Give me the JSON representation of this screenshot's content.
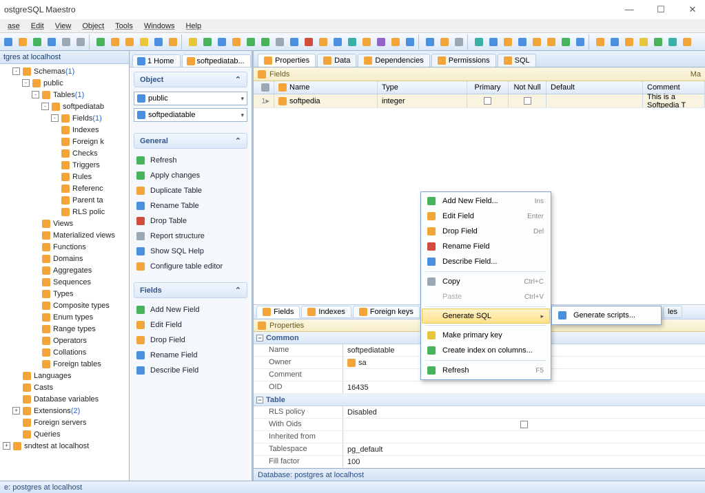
{
  "titlebar": {
    "title": "ostgreSQL Maestro"
  },
  "menu": {
    "items": [
      "ase",
      "Edit",
      "View",
      "Object",
      "Tools",
      "Windows",
      "Help"
    ]
  },
  "left": {
    "header": "tgres at localhost",
    "tree": [
      {
        "depth": 1,
        "exp": "-",
        "ico": "🟧",
        "label": "Schemas",
        "count": "(1)"
      },
      {
        "depth": 2,
        "exp": "-",
        "ico": "🔷",
        "label": "public"
      },
      {
        "depth": 3,
        "exp": "-",
        "ico": "🟧",
        "label": "Tables",
        "count": "(1)"
      },
      {
        "depth": 4,
        "exp": "-",
        "ico": "📄",
        "label": "softpediatab"
      },
      {
        "depth": 5,
        "exp": "-",
        "ico": "🟧",
        "label": "Fields",
        "count": "(1)"
      },
      {
        "depth": 5,
        "exp": "",
        "ico": "🟧",
        "label": "Indexes"
      },
      {
        "depth": 5,
        "exp": "",
        "ico": "🟧",
        "label": "Foreign k"
      },
      {
        "depth": 5,
        "exp": "",
        "ico": "🟧",
        "label": "Checks"
      },
      {
        "depth": 5,
        "exp": "",
        "ico": "🟧",
        "label": "Triggers"
      },
      {
        "depth": 5,
        "exp": "",
        "ico": "🟧",
        "label": "Rules"
      },
      {
        "depth": 5,
        "exp": "",
        "ico": "🟧",
        "label": "Referenc"
      },
      {
        "depth": 5,
        "exp": "",
        "ico": "🟧",
        "label": "Parent ta"
      },
      {
        "depth": 5,
        "exp": "",
        "ico": "🟧",
        "label": "RLS polic"
      },
      {
        "depth": 3,
        "exp": "",
        "ico": "🟧",
        "label": "Views"
      },
      {
        "depth": 3,
        "exp": "",
        "ico": "🟧",
        "label": "Materialized views"
      },
      {
        "depth": 3,
        "exp": "",
        "ico": "🟧",
        "label": "Functions"
      },
      {
        "depth": 3,
        "exp": "",
        "ico": "🟧",
        "label": "Domains"
      },
      {
        "depth": 3,
        "exp": "",
        "ico": "🟧",
        "label": "Aggregates"
      },
      {
        "depth": 3,
        "exp": "",
        "ico": "🟧",
        "label": "Sequences"
      },
      {
        "depth": 3,
        "exp": "",
        "ico": "🟧",
        "label": "Types"
      },
      {
        "depth": 3,
        "exp": "",
        "ico": "🟧",
        "label": "Composite types"
      },
      {
        "depth": 3,
        "exp": "",
        "ico": "🟧",
        "label": "Enum types"
      },
      {
        "depth": 3,
        "exp": "",
        "ico": "🟧",
        "label": "Range types"
      },
      {
        "depth": 3,
        "exp": "",
        "ico": "🟧",
        "label": "Operators"
      },
      {
        "depth": 3,
        "exp": "",
        "ico": "🟧",
        "label": "Collations"
      },
      {
        "depth": 3,
        "exp": "",
        "ico": "🟧",
        "label": "Foreign tables"
      },
      {
        "depth": 1,
        "exp": "",
        "ico": "🟧",
        "label": "Languages"
      },
      {
        "depth": 1,
        "exp": "",
        "ico": "🟧",
        "label": "Casts"
      },
      {
        "depth": 1,
        "exp": "",
        "ico": "🟧",
        "label": "Database variables"
      },
      {
        "depth": 1,
        "exp": "+",
        "ico": "🟧",
        "label": "Extensions",
        "count": "(2)"
      },
      {
        "depth": 1,
        "exp": "",
        "ico": "🟧",
        "label": "Foreign servers"
      },
      {
        "depth": 1,
        "exp": "",
        "ico": "🟧",
        "label": "Queries"
      },
      {
        "depth": 0,
        "exp": "+",
        "ico": "🔵",
        "label": "sndtest at localhost"
      }
    ]
  },
  "mid": {
    "tabs": [
      {
        "label": "Home",
        "icon": "🔵",
        "active": false
      },
      {
        "label": "softpediatab...",
        "icon": "📄",
        "active": true
      }
    ],
    "sections": {
      "object": {
        "title": "Object",
        "combos": [
          {
            "icon": "🔷",
            "value": "public"
          },
          {
            "icon": "📄",
            "value": "softpediatable"
          }
        ]
      },
      "general": {
        "title": "General",
        "items": [
          {
            "ico": "🔄",
            "c": "ic-green",
            "label": "Refresh"
          },
          {
            "ico": "✔",
            "c": "ic-green",
            "label": "Apply changes"
          },
          {
            "ico": "⿻",
            "c": "ic-orange",
            "label": "Duplicate Table"
          },
          {
            "ico": "✎",
            "c": "ic-blue",
            "label": "Rename Table"
          },
          {
            "ico": "✖",
            "c": "ic-red",
            "label": "Drop Table"
          },
          {
            "ico": "⚙",
            "c": "ic-gray",
            "label": "Report structure"
          },
          {
            "ico": "?",
            "c": "ic-blue",
            "label": "Show SQL Help"
          },
          {
            "ico": "⚙",
            "c": "ic-orange",
            "label": "Configure table editor"
          }
        ]
      },
      "fields": {
        "title": "Fields",
        "items": [
          {
            "ico": "+",
            "c": "ic-green",
            "label": "Add New Field"
          },
          {
            "ico": "✎",
            "c": "ic-orange",
            "label": "Edit Field"
          },
          {
            "ico": "–",
            "c": "ic-orange",
            "label": "Drop Field"
          },
          {
            "ico": "✎",
            "c": "ic-blue",
            "label": "Rename Field"
          },
          {
            "ico": "ⓘ",
            "c": "ic-blue",
            "label": "Describe Field"
          }
        ]
      }
    }
  },
  "main": {
    "tabs": [
      {
        "label": "Properties",
        "active": true
      },
      {
        "label": "Data"
      },
      {
        "label": "Dependencies"
      },
      {
        "label": "Permissions"
      },
      {
        "label": "SQL"
      }
    ],
    "fields_bar": {
      "label": "Fields",
      "right": "Ma"
    },
    "grid": {
      "cols": [
        "",
        "Name",
        "Type",
        "Primary",
        "Not Null",
        "Default",
        "Comment"
      ],
      "row": {
        "num": "1",
        "name": "softpedia",
        "type": "integer",
        "primary": false,
        "notnull": false,
        "default": "",
        "comment": "This is a Softpedia T"
      }
    },
    "sub_tabs": [
      "Fields",
      "Indexes",
      "Foreign keys",
      "",
      "les"
    ],
    "prop_bar": "Properties",
    "props": {
      "common_title": "Common",
      "common": [
        {
          "k": "Name",
          "v": "softpediatable"
        },
        {
          "k": "Owner",
          "v": "sa",
          "ico": "👤"
        },
        {
          "k": "Comment",
          "v": ""
        },
        {
          "k": "OID",
          "v": "16435"
        }
      ],
      "table_title": "Table",
      "table": [
        {
          "k": "RLS policy",
          "v": "Disabled"
        },
        {
          "k": "With Oids",
          "v": "",
          "chk": true
        },
        {
          "k": "Inherited from",
          "v": ""
        },
        {
          "k": "Tablespace",
          "v": "pg_default"
        },
        {
          "k": "Fill factor",
          "v": "100"
        }
      ]
    },
    "mid_status": "Database: postgres at localhost"
  },
  "footer": "e: postgres at localhost",
  "ctx": {
    "items": [
      {
        "type": "item",
        "ico": "+",
        "c": "ic-green",
        "label": "Add New Field...",
        "short": "Ins"
      },
      {
        "type": "item",
        "ico": "✎",
        "c": "ic-orange",
        "label": "Edit Field",
        "short": "Enter"
      },
      {
        "type": "item",
        "ico": "–",
        "c": "ic-orange",
        "label": "Drop Field",
        "short": "Del"
      },
      {
        "type": "item",
        "ico": "✎",
        "c": "ic-red",
        "label": "Rename Field"
      },
      {
        "type": "item",
        "ico": "ⓘ",
        "c": "ic-blue",
        "label": "Describe Field..."
      },
      {
        "type": "sep"
      },
      {
        "type": "item",
        "ico": "⿻",
        "c": "ic-gray",
        "label": "Copy",
        "short": "Ctrl+C"
      },
      {
        "type": "item",
        "ico": "",
        "c": "",
        "label": "Paste",
        "short": "Ctrl+V",
        "disabled": true
      },
      {
        "type": "sep"
      },
      {
        "type": "item",
        "ico": "",
        "c": "",
        "label": "Generate SQL",
        "arrow": true,
        "highlight": true
      },
      {
        "type": "sep"
      },
      {
        "type": "item",
        "ico": "🔑",
        "c": "ic-yellow",
        "label": "Make primary key"
      },
      {
        "type": "item",
        "ico": "⚙",
        "c": "ic-green",
        "label": "Create index on columns..."
      },
      {
        "type": "sep"
      },
      {
        "type": "item",
        "ico": "🔄",
        "c": "ic-green",
        "label": "Refresh",
        "short": "F5"
      }
    ],
    "sub": {
      "label": "Generate scripts...",
      "trail": "les"
    }
  }
}
